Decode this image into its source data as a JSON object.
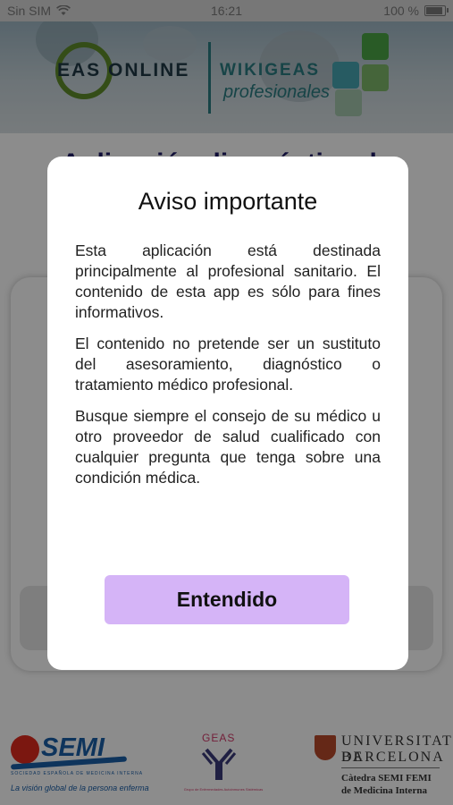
{
  "status_bar": {
    "carrier": "Sin SIM",
    "time": "16:21",
    "battery_percent_label": "100 %",
    "battery_level": 1.0
  },
  "header": {
    "logo_left_text": "EAS ONLINE",
    "logo_right_text": "WIKIGEAS",
    "logo_right_subtitle": "profesionales"
  },
  "background": {
    "title": "Aplicación diagnóstica de"
  },
  "modal": {
    "title": "Aviso importante",
    "paragraphs": [
      "Esta aplicación está destinada principalmente al profesional sanitario. El contenido de esta app es sólo para fines informativos.",
      "El contenido no pretende ser un sustituto del asesoramiento, diagnóstico o tratamiento médico profesional.",
      "Busque siempre el consejo de su médico u otro proveedor de salud cualificado con cualquier pregunta que tenga sobre una condición médica."
    ],
    "button_label": "Entendido"
  },
  "footer": {
    "semi_name": "SEMI",
    "semi_full": "SOCIEDAD ESPAÑOLA DE MEDICINA INTERNA",
    "semi_tagline": "La visión global de la persona enferma",
    "geas_name": "GEAS",
    "geas_full": "Grupo de Enfermedades Autoinmunes Sistémicas",
    "ub_line1": "UNIVERSITAT DE",
    "ub_line2": "BARCELONA",
    "ub_chair_line1": "Càtedra SEMI FEMI",
    "ub_chair_line2": "de Medicina Interna"
  },
  "colors": {
    "modal_button": "#d5b4f7",
    "background_title": "#1e1a66",
    "semi_blue": "#1b5fa8",
    "semi_red": "#e12b1e",
    "geas_pink": "#d23b6a"
  }
}
